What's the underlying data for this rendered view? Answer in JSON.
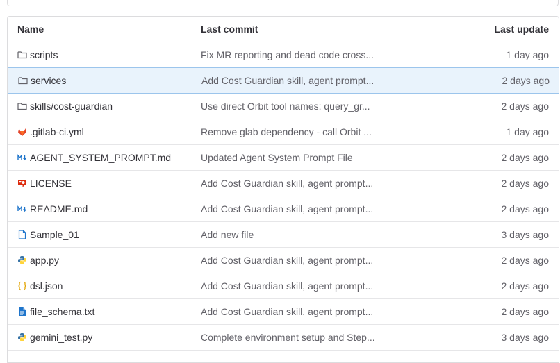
{
  "table": {
    "headers": {
      "name": "Name",
      "last_commit": "Last commit",
      "last_update": "Last update"
    },
    "rows": [
      {
        "icon": "folder-icon",
        "name": "scripts",
        "commit": "Fix MR reporting and dead code cross...",
        "updated": "1 day ago"
      },
      {
        "icon": "folder-icon",
        "name": "services",
        "commit": "Add Cost Guardian skill, agent prompt...",
        "updated": "2 days ago"
      },
      {
        "icon": "folder-icon",
        "name": "skills/cost-guardian",
        "commit": "Use direct Orbit tool names: query_gr...",
        "updated": "2 days ago"
      },
      {
        "icon": "gitlab-icon",
        "name": ".gitlab-ci.yml",
        "commit": "Remove glab dependency - call Orbit ...",
        "updated": "1 day ago"
      },
      {
        "icon": "markdown-icon",
        "name": "AGENT_SYSTEM_PROMPT.md",
        "commit": "Updated Agent System Prompt File",
        "updated": "2 days ago"
      },
      {
        "icon": "license-icon",
        "name": "LICENSE",
        "commit": "Add Cost Guardian skill, agent prompt...",
        "updated": "2 days ago"
      },
      {
        "icon": "markdown-icon",
        "name": "README.md",
        "commit": "Add Cost Guardian skill, agent prompt...",
        "updated": "2 days ago"
      },
      {
        "icon": "file-icon",
        "name": "Sample_01",
        "commit": "Add new file",
        "updated": "3 days ago"
      },
      {
        "icon": "python-icon",
        "name": "app.py",
        "commit": "Add Cost Guardian skill, agent prompt...",
        "updated": "2 days ago"
      },
      {
        "icon": "json-icon",
        "name": "dsl.json",
        "commit": "Add Cost Guardian skill, agent prompt...",
        "updated": "2 days ago"
      },
      {
        "icon": "text-file-icon",
        "name": "file_schema.txt",
        "commit": "Add Cost Guardian skill, agent prompt...",
        "updated": "2 days ago"
      },
      {
        "icon": "python-icon",
        "name": "gemini_test.py",
        "commit": "Complete environment setup and Step...",
        "updated": "3 days ago"
      }
    ]
  },
  "colors": {
    "selected_row_bg": "#e9f3fc",
    "selected_row_border": "#9cc5ec",
    "gitlab_orange": "#e24329",
    "markdown_blue": "#1f75cb",
    "license_red": "#dd2b0e",
    "python_blue": "#3572a5",
    "python_yellow": "#ffd43b",
    "json_yellow": "#f1c40f"
  }
}
